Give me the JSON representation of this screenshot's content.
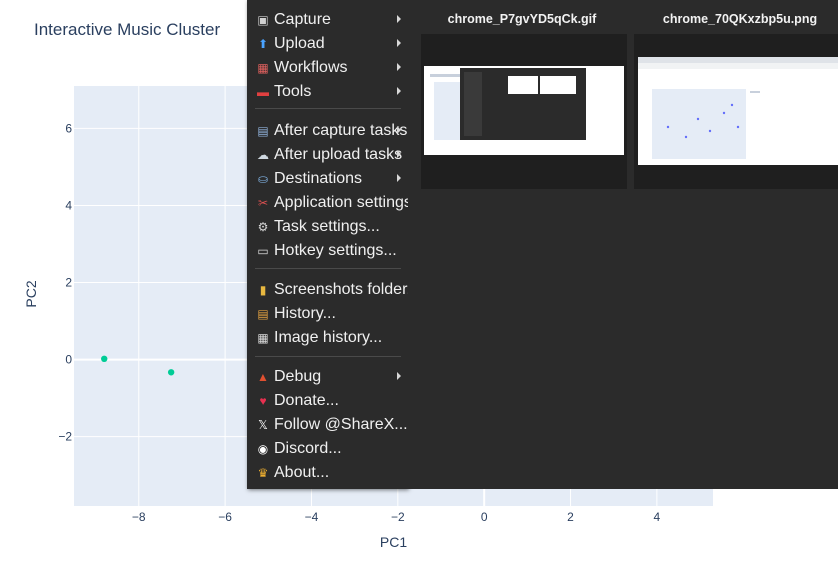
{
  "chart": {
    "title": "Interactive Music Cluster"
  },
  "chart_data": {
    "type": "scatter",
    "title": "Interactive Music Cluster",
    "xlabel": "PC1",
    "ylabel": "PC2",
    "xlim": [
      -9.5,
      5.3
    ],
    "ylim": [
      -3.8,
      7.1
    ],
    "x_ticks": [
      "−8",
      "−6",
      "−4",
      "−2",
      "0",
      "2",
      "4"
    ],
    "y_ticks": [
      "6",
      "4",
      "2",
      "0",
      "−2"
    ],
    "x_tick_values": [
      -8,
      -6,
      -4,
      -2,
      0,
      2,
      4
    ],
    "y_tick_values": [
      6,
      4,
      2,
      0,
      -2
    ],
    "series": [
      {
        "color": "#00cc96",
        "x": [
          -8.8,
          -7.25
        ],
        "y": [
          0.02,
          -0.33
        ]
      }
    ],
    "grid": true,
    "colors": {
      "plot_bg": "#e5ecf6",
      "grid": "#ffffff",
      "text": "#2a3f5f"
    }
  },
  "menu": {
    "items": [
      {
        "label": "Capture",
        "icon": "capture-icon",
        "submenu": true
      },
      {
        "label": "Upload",
        "icon": "upload-icon",
        "submenu": true
      },
      {
        "label": "Workflows",
        "icon": "workflows-icon",
        "submenu": true
      },
      {
        "label": "Tools",
        "icon": "tools-icon",
        "submenu": true
      },
      {
        "label": "After capture tasks",
        "icon": "after-capture-icon",
        "submenu": true
      },
      {
        "label": "After upload tasks",
        "icon": "after-upload-icon",
        "submenu": true
      },
      {
        "label": "Destinations",
        "icon": "destinations-icon",
        "submenu": true
      },
      {
        "label": "Application settings...",
        "icon": "application-settings-icon",
        "submenu": false
      },
      {
        "label": "Task settings...",
        "icon": "gear-icon",
        "submenu": false
      },
      {
        "label": "Hotkey settings...",
        "icon": "keyboard-icon",
        "submenu": false
      },
      {
        "label": "Screenshots folder...",
        "icon": "folder-icon",
        "submenu": false
      },
      {
        "label": "History...",
        "icon": "history-icon",
        "submenu": false
      },
      {
        "label": "Image history...",
        "icon": "image-history-icon",
        "submenu": false
      },
      {
        "label": "Debug",
        "icon": "debug-icon",
        "submenu": true
      },
      {
        "label": "Donate...",
        "icon": "heart-icon",
        "submenu": false
      },
      {
        "label": "Follow @ShareX...",
        "icon": "x-logo-icon",
        "submenu": false
      },
      {
        "label": "Discord...",
        "icon": "discord-icon",
        "submenu": false
      },
      {
        "label": "About...",
        "icon": "crown-icon",
        "submenu": false
      }
    ]
  },
  "thumbnails": [
    {
      "filename": "chrome_P7gvYD5qCk.gif"
    },
    {
      "filename": "chrome_70QKxzbp5u.png"
    }
  ]
}
